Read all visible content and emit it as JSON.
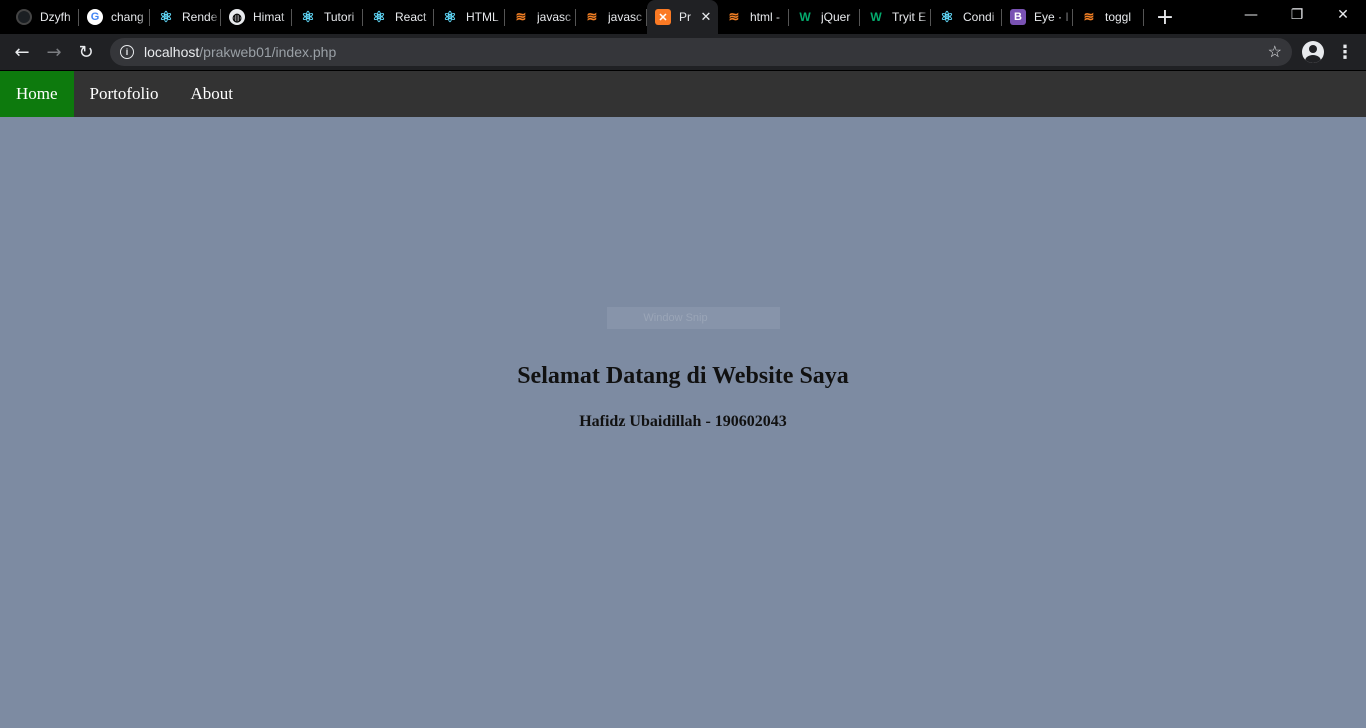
{
  "browser": {
    "tabs": [
      {
        "title": "Dzyfh",
        "icon": "github-icon"
      },
      {
        "title": "chang",
        "icon": "google-icon"
      },
      {
        "title": "Rende",
        "icon": "react-icon"
      },
      {
        "title": "Himat",
        "icon": "globe-icon"
      },
      {
        "title": "Tutori",
        "icon": "react-icon"
      },
      {
        "title": "React",
        "icon": "react-icon"
      },
      {
        "title": "HTML",
        "icon": "react-icon"
      },
      {
        "title": "javasc",
        "icon": "stackoverflow-icon"
      },
      {
        "title": "javasc",
        "icon": "stackoverflow-icon"
      },
      {
        "title": "Pr",
        "icon": "xampp-icon",
        "active": true
      },
      {
        "title": "html -",
        "icon": "stackoverflow-icon"
      },
      {
        "title": "jQuer",
        "icon": "w3schools-icon"
      },
      {
        "title": "Tryit E",
        "icon": "w3schools-icon"
      },
      {
        "title": "Condi",
        "icon": "react-icon"
      },
      {
        "title": "Eye · I",
        "icon": "bootstrap-icon"
      },
      {
        "title": "toggl",
        "icon": "stackoverflow-icon"
      }
    ],
    "new_tab": "+",
    "window": {
      "minimize": "—",
      "restore": "❐",
      "close": "✕"
    },
    "back": "←",
    "forward": "→",
    "reload": "↻",
    "url_host": "localhost",
    "url_path": "/prakweb01/index.php",
    "bookmark": "☆",
    "menu": "⋮"
  },
  "site_nav": {
    "items": [
      {
        "label": "Home",
        "active": true
      },
      {
        "label": "Portofolio",
        "active": false
      },
      {
        "label": "About",
        "active": false
      }
    ]
  },
  "overlay": {
    "window_snip": "Window Snip"
  },
  "main": {
    "title": "Selamat Datang di Website Saya",
    "subtitle": "Hafidz Ubaidillah - 190602043"
  },
  "colors": {
    "page_background": "#7d8ba2",
    "nav_background": "#333333",
    "nav_active": "#0d7a0d"
  }
}
